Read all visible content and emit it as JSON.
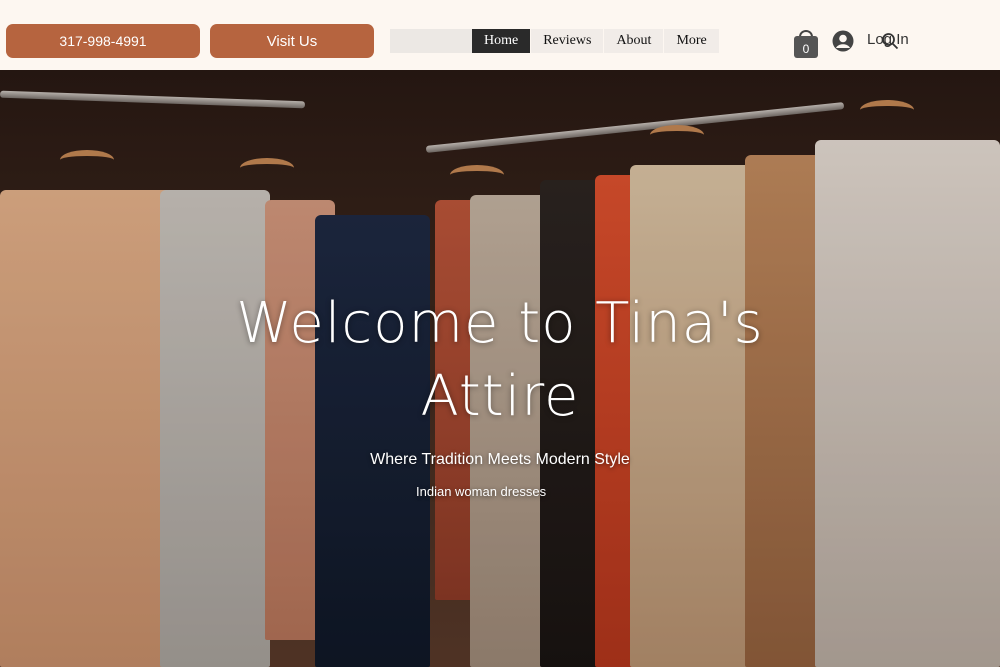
{
  "header": {
    "phone_label": "317-998-4991",
    "visit_label": "Visit Us",
    "nav": [
      "Home",
      "Reviews",
      "About",
      "More"
    ],
    "active_nav": "Home",
    "cart_count": "0",
    "login_label": "Log In"
  },
  "hero": {
    "title_line1": "Welcome to Tina's",
    "title_line2": "Attire",
    "tagline": "Where Tradition Meets Modern Style",
    "image_alt": "Indian woman dresses"
  },
  "colors": {
    "accent": "#b6643f",
    "header_bg": "#fdf7f1",
    "nav_active": "#2a2a2a"
  },
  "icons": [
    "cart-icon",
    "avatar-icon",
    "search-icon"
  ]
}
